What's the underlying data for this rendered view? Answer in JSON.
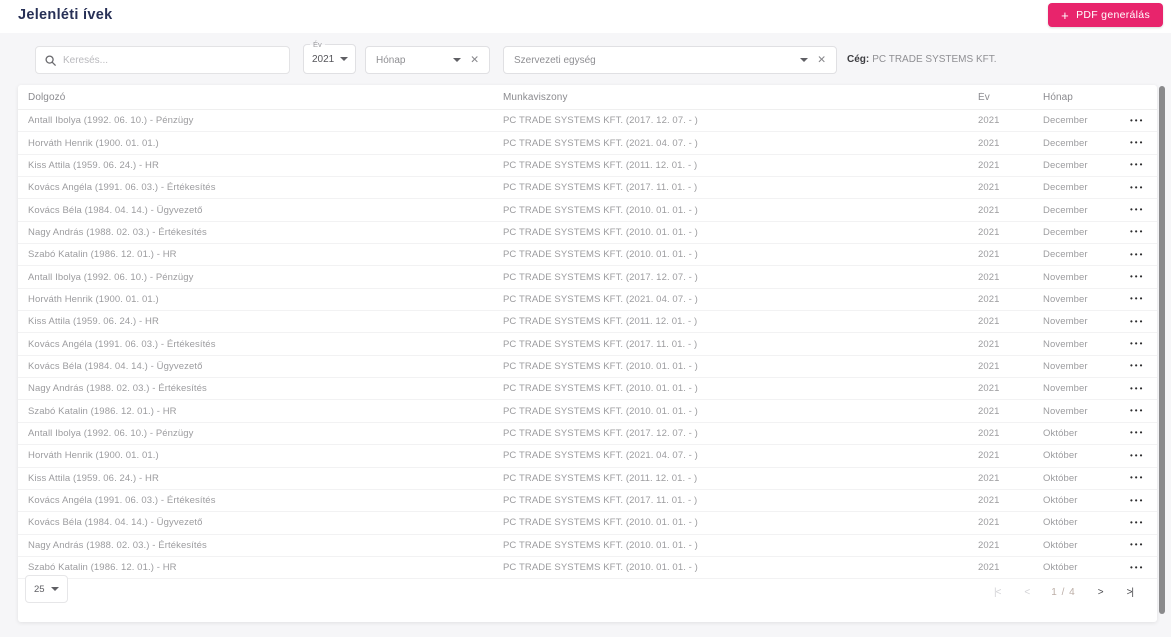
{
  "header": {
    "title": "Jelenléti ívek",
    "pdf_button": {
      "icon": "+",
      "label": "PDF generálás"
    }
  },
  "filters": {
    "search": {
      "placeholder": "Keresés..."
    },
    "year": {
      "label": "Év",
      "value": "2021"
    },
    "month": {
      "placeholder": "Hónap",
      "clear_icon": "✕"
    },
    "org_unit": {
      "placeholder": "Szervezeti egység",
      "clear_icon": "✕"
    },
    "company": {
      "label": "Cég:",
      "value": "PC TRADE SYSTEMS KFT."
    }
  },
  "table": {
    "columns": {
      "employee": "Dolgozó",
      "employment": "Munkaviszony",
      "year": "Év",
      "month": "Hónap"
    },
    "actions_icon": "•••",
    "rows": [
      {
        "employee": "Antall Ibolya (1992. 06. 10.) - Pénzügy",
        "employment": "PC TRADE SYSTEMS KFT. (2017. 12. 07. - )",
        "year": "2021",
        "month": "December"
      },
      {
        "employee": "Horváth Henrik (1900. 01. 01.)",
        "employment": "PC TRADE SYSTEMS KFT. (2021. 04. 07. - )",
        "year": "2021",
        "month": "December"
      },
      {
        "employee": "Kiss Attila (1959. 06. 24.) - HR",
        "employment": "PC TRADE SYSTEMS KFT. (2011. 12. 01. - )",
        "year": "2021",
        "month": "December"
      },
      {
        "employee": "Kovács Angéla (1991. 06. 03.) - Értékesítés",
        "employment": "PC TRADE SYSTEMS KFT. (2017. 11. 01. - )",
        "year": "2021",
        "month": "December"
      },
      {
        "employee": "Kovács Béla (1984. 04. 14.) - Ügyvezető",
        "employment": "PC TRADE SYSTEMS KFT. (2010. 01. 01. - )",
        "year": "2021",
        "month": "December"
      },
      {
        "employee": "Nagy András (1988. 02. 03.) - Értékesítés",
        "employment": "PC TRADE SYSTEMS KFT. (2010. 01. 01. - )",
        "year": "2021",
        "month": "December"
      },
      {
        "employee": "Szabó Katalin (1986. 12. 01.) - HR",
        "employment": "PC TRADE SYSTEMS KFT. (2010. 01. 01. - )",
        "year": "2021",
        "month": "December"
      },
      {
        "employee": "Antall Ibolya (1992. 06. 10.) - Pénzügy",
        "employment": "PC TRADE SYSTEMS KFT. (2017. 12. 07. - )",
        "year": "2021",
        "month": "November"
      },
      {
        "employee": "Horváth Henrik (1900. 01. 01.)",
        "employment": "PC TRADE SYSTEMS KFT. (2021. 04. 07. - )",
        "year": "2021",
        "month": "November"
      },
      {
        "employee": "Kiss Attila (1959. 06. 24.) - HR",
        "employment": "PC TRADE SYSTEMS KFT. (2011. 12. 01. - )",
        "year": "2021",
        "month": "November"
      },
      {
        "employee": "Kovács Angéla (1991. 06. 03.) - Értékesítés",
        "employment": "PC TRADE SYSTEMS KFT. (2017. 11. 01. - )",
        "year": "2021",
        "month": "November"
      },
      {
        "employee": "Kovács Béla (1984. 04. 14.) - Ügyvezető",
        "employment": "PC TRADE SYSTEMS KFT. (2010. 01. 01. - )",
        "year": "2021",
        "month": "November"
      },
      {
        "employee": "Nagy András (1988. 02. 03.) - Értékesítés",
        "employment": "PC TRADE SYSTEMS KFT. (2010. 01. 01. - )",
        "year": "2021",
        "month": "November"
      },
      {
        "employee": "Szabó Katalin (1986. 12. 01.) - HR",
        "employment": "PC TRADE SYSTEMS KFT. (2010. 01. 01. - )",
        "year": "2021",
        "month": "November"
      },
      {
        "employee": "Antall Ibolya (1992. 06. 10.) - Pénzügy",
        "employment": "PC TRADE SYSTEMS KFT. (2017. 12. 07. - )",
        "year": "2021",
        "month": "Október"
      },
      {
        "employee": "Horváth Henrik (1900. 01. 01.)",
        "employment": "PC TRADE SYSTEMS KFT. (2021. 04. 07. - )",
        "year": "2021",
        "month": "Október"
      },
      {
        "employee": "Kiss Attila (1959. 06. 24.) - HR",
        "employment": "PC TRADE SYSTEMS KFT. (2011. 12. 01. - )",
        "year": "2021",
        "month": "Október"
      },
      {
        "employee": "Kovács Angéla (1991. 06. 03.) - Értékesítés",
        "employment": "PC TRADE SYSTEMS KFT. (2017. 11. 01. - )",
        "year": "2021",
        "month": "Október"
      },
      {
        "employee": "Kovács Béla (1984. 04. 14.) - Ügyvezető",
        "employment": "PC TRADE SYSTEMS KFT. (2010. 01. 01. - )",
        "year": "2021",
        "month": "Október"
      },
      {
        "employee": "Nagy András (1988. 02. 03.) - Értékesítés",
        "employment": "PC TRADE SYSTEMS KFT. (2010. 01. 01. - )",
        "year": "2021",
        "month": "Október"
      },
      {
        "employee": "Szabó Katalin (1986. 12. 01.) - HR",
        "employment": "PC TRADE SYSTEMS KFT. (2010. 01. 01. - )",
        "year": "2021",
        "month": "Október"
      }
    ]
  },
  "footer": {
    "page_size": "25",
    "page_indicator": "1 / 4",
    "first_icon": "|<",
    "prev_icon": "<",
    "next_icon": ">",
    "last_icon": ">|"
  },
  "colors": {
    "accent": "#e8246c",
    "title": "#273056",
    "page_background": "#f6f6f8",
    "card_background": "#ffffff"
  }
}
